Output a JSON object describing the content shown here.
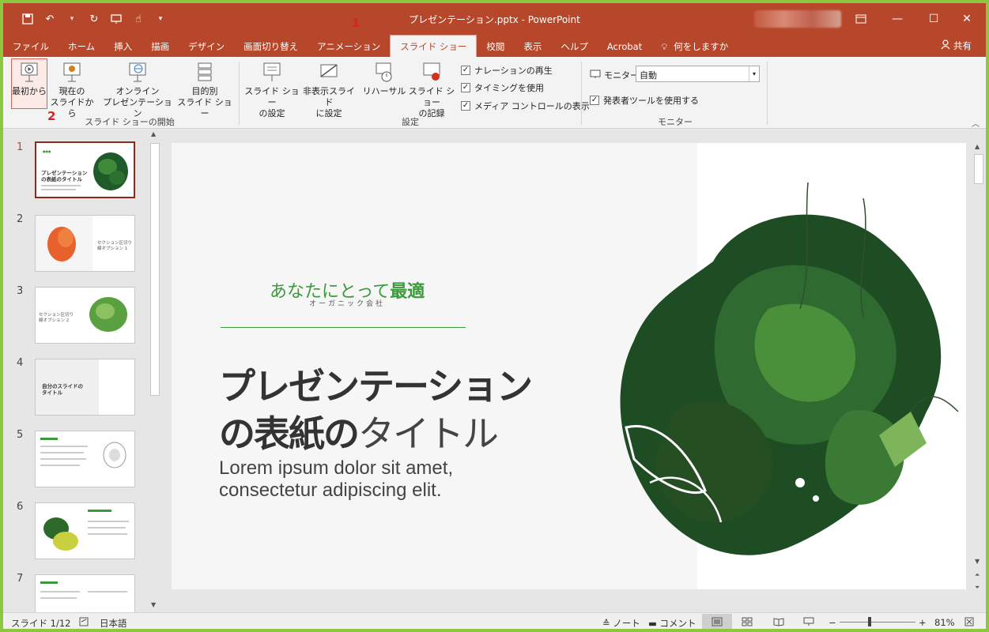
{
  "titlebar": {
    "doc_title": "プレゼンテーション.pptx  -  PowerPoint",
    "qat_icons": [
      "save-icon",
      "undo-icon",
      "redo-icon",
      "present-icon",
      "touch-icon",
      "customize-icon"
    ]
  },
  "tabs": [
    {
      "label": "ファイル"
    },
    {
      "label": "ホーム"
    },
    {
      "label": "挿入"
    },
    {
      "label": "描画"
    },
    {
      "label": "デザイン"
    },
    {
      "label": "画面切り替え"
    },
    {
      "label": "アニメーション"
    },
    {
      "label": "スライド ショー",
      "active": true
    },
    {
      "label": "校閲"
    },
    {
      "label": "表示"
    },
    {
      "label": "ヘルプ"
    },
    {
      "label": "Acrobat"
    },
    {
      "label": "何をしますか"
    }
  ],
  "share_label": "共有",
  "annotations": {
    "one": "1",
    "two": "2"
  },
  "ribbon": {
    "start_group": {
      "label": "スライド ショーの開始",
      "from_beginning": "最初から",
      "from_current_1": "現在の",
      "from_current_2": "スライドから",
      "online_1": "オンライン",
      "online_2": "プレゼンテーション",
      "custom_1": "目的別",
      "custom_2": "スライド ショー"
    },
    "setup_group": {
      "label": "設定",
      "setup_1": "スライド ショー",
      "setup_2": "の設定",
      "hide_1": "非表示スライド",
      "hide_2": "に設定",
      "rehearse": "リハーサル",
      "record_1": "スライド ショー",
      "record_2": "の記録",
      "check_narration": "ナレーションの再生",
      "check_timing": "タイミングを使用",
      "check_media": "メディア コントロールの表示"
    },
    "monitor_group": {
      "label": "モニター",
      "monitor_label": "モニター:",
      "monitor_value": "自動",
      "presenter_view": "発表者ツールを使用する"
    }
  },
  "thumbnails": [
    {
      "num": "1",
      "title_1": "プレゼンテーション",
      "title_2": "の表紙のタイトル"
    },
    {
      "num": "2",
      "title_1": "セクション区切り",
      "title_2": "線オプション 1"
    },
    {
      "num": "3",
      "title_1": "セクション区切り",
      "title_2": "線オプション 2"
    },
    {
      "num": "4",
      "title_1": "自分のスライドの",
      "title_2": "タイトル"
    },
    {
      "num": "5",
      "title_1": "",
      "title_2": ""
    },
    {
      "num": "6",
      "title_1": "",
      "title_2": ""
    },
    {
      "num": "7",
      "title_1": "",
      "title_2": ""
    }
  ],
  "slide": {
    "logo_main": "あなたにとって",
    "logo_bold": "最適",
    "logo_sub": "オーガニック会社",
    "title_line1": "プレゼンテーション",
    "title_line2_bold": "の表紙の",
    "title_line2_light": "タイトル",
    "subtitle_1": "Lorem ipsum dolor sit amet,",
    "subtitle_2": "consectetur adipiscing elit."
  },
  "status": {
    "slide_count": "スライド 1/12",
    "language": "日本語",
    "notes": "ノート",
    "comments": "コメント",
    "zoom": "81%"
  },
  "colors": {
    "accent": "#b7472a",
    "green": "#3c9a3c",
    "annotation": "#e02020"
  }
}
